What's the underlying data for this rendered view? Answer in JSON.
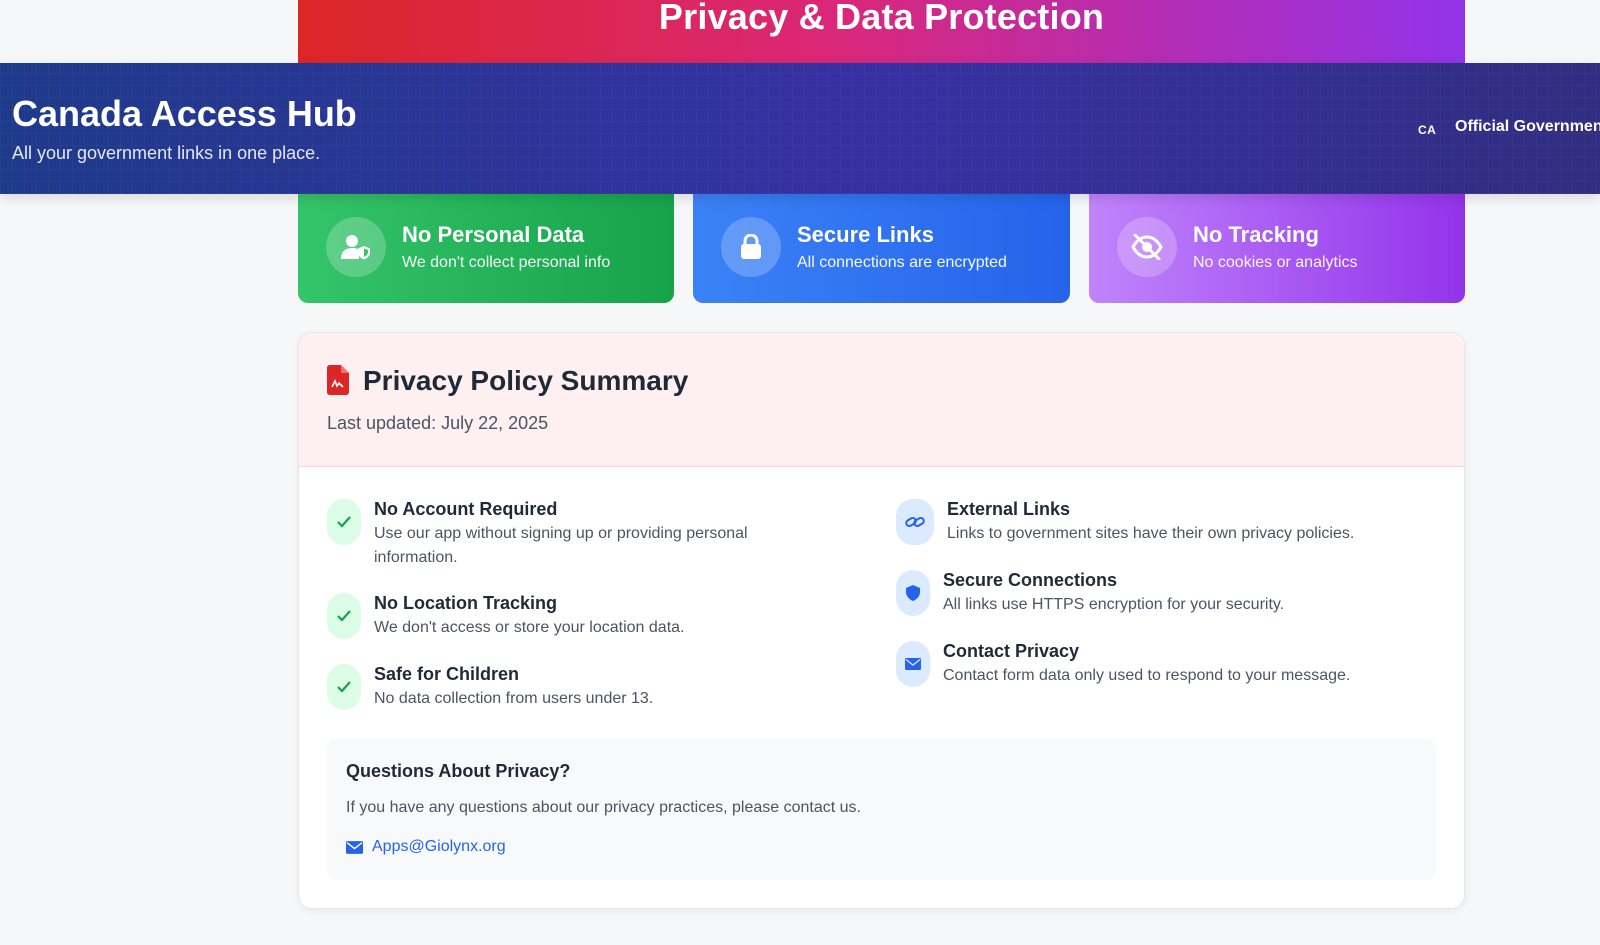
{
  "hero": {
    "title": "Privacy & Data Protection"
  },
  "header": {
    "title": "Canada Access Hub",
    "tagline": "All your government links in one place.",
    "country_code": "CA",
    "badge": "Official Government"
  },
  "features": [
    {
      "title": "No Personal Data",
      "desc": "We don't collect personal info",
      "icon": "user-shield-icon",
      "color": "#16a34a"
    },
    {
      "title": "Secure Links",
      "desc": "All connections are encrypted",
      "icon": "lock-icon",
      "color": "#2563eb"
    },
    {
      "title": "No Tracking",
      "desc": "No cookies or analytics",
      "icon": "eye-slash-icon",
      "color": "#9333ea"
    }
  ],
  "policy": {
    "title": "Privacy Policy Summary",
    "updated": "Last updated: July 22, 2025",
    "left_items": [
      {
        "title": "No Account Required",
        "desc": "Use our app without signing up or providing personal information.",
        "icon": "check-icon"
      },
      {
        "title": "No Location Tracking",
        "desc": "We don't access or store your location data.",
        "icon": "check-icon"
      },
      {
        "title": "Safe for Children",
        "desc": "No data collection from users under 13.",
        "icon": "check-icon"
      }
    ],
    "right_items": [
      {
        "title": "External Links",
        "desc": "Links to government sites have their own privacy policies.",
        "icon": "link-icon"
      },
      {
        "title": "Secure Connections",
        "desc": "All links use HTTPS encryption for your security.",
        "icon": "shield-icon"
      },
      {
        "title": "Contact Privacy",
        "desc": "Contact form data only used to respond to your message.",
        "icon": "envelope-icon"
      }
    ],
    "questions": {
      "title": "Questions About Privacy?",
      "text": "If you have any questions about our privacy practices, please contact us.",
      "email": "Apps@Giolynx.org"
    }
  },
  "colors": {
    "accent_blue": "#2563eb",
    "header_bg": "#1e3a8a",
    "check_green": "#16a34a",
    "doc_red": "#dc2626"
  }
}
